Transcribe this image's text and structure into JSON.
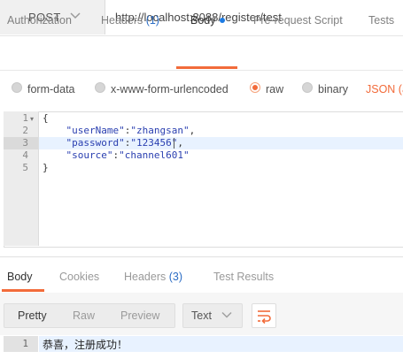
{
  "request": {
    "method": "POST",
    "url": "http://localhost:8088/register/test"
  },
  "request_tabs": [
    {
      "label": "Authorization"
    },
    {
      "label": "Headers",
      "count": "(1)"
    },
    {
      "label": "Body"
    },
    {
      "label": "Pre-request Script"
    },
    {
      "label": "Tests"
    }
  ],
  "body_types": {
    "form_data": "form-data",
    "urlencoded": "x-www-form-urlencoded",
    "raw": "raw",
    "binary": "binary",
    "content_type": "JSON (a"
  },
  "editor": {
    "line_numbers": [
      "1",
      "2",
      "3",
      "4",
      "5"
    ],
    "lines": {
      "l1": "{",
      "l2": {
        "key": "\"userName\"",
        "sep": ":",
        "value": "\"zhangsan\"",
        "tail": ","
      },
      "l3": {
        "key": "\"password\"",
        "sep": ":",
        "value": "\"123456\"",
        "tail": ","
      },
      "l4": {
        "key": "\"source\"",
        "sep": ":",
        "value": "\"channel601\"",
        "tail": ""
      },
      "l5": "}"
    }
  },
  "response_tabs": [
    {
      "label": "Body"
    },
    {
      "label": "Cookies"
    },
    {
      "label": "Headers",
      "count": "(3)"
    },
    {
      "label": "Test Results"
    }
  ],
  "response_toolbar": {
    "pretty": "Pretty",
    "raw": "Raw",
    "preview": "Preview",
    "format": "Text"
  },
  "response": {
    "line_number": "1",
    "text": "恭喜，注册成功！"
  },
  "colors": {
    "accent": "#f26b3a",
    "count_blue": "#2b6cc4",
    "json_key": "#2a3fb0"
  }
}
